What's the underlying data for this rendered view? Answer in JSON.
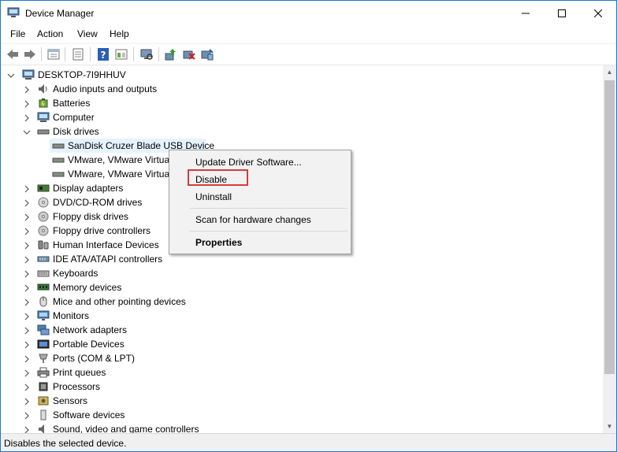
{
  "window": {
    "title": "Device Manager",
    "controls": {
      "minimize": "–",
      "maximize": "☐",
      "close": "✕"
    }
  },
  "menu": [
    "File",
    "Action",
    "View",
    "Help"
  ],
  "toolbar": [
    "back-icon",
    "forward-icon",
    "properties-view-icon",
    "show-hidden-icon",
    "help-icon",
    "view-icon",
    "scan-icon",
    "update-driver-icon",
    "disable-device-icon",
    "uninstall-device-icon"
  ],
  "tree": {
    "root": "DESKTOP-7I9HHUV",
    "items": [
      {
        "label": "Audio inputs and outputs",
        "icon": "speaker-icon"
      },
      {
        "label": "Batteries",
        "icon": "battery-icon"
      },
      {
        "label": "Computer",
        "icon": "computer-icon"
      },
      {
        "label": "Disk drives",
        "icon": "disk-drive-icon",
        "expanded": true,
        "children": [
          {
            "label": "SanDisk Cruzer Blade USB Device",
            "selected": true
          },
          {
            "label": "VMware, VMware Virtua"
          },
          {
            "label": "VMware, VMware Virtua"
          }
        ]
      },
      {
        "label": "Display adapters",
        "icon": "display-adapter-icon"
      },
      {
        "label": "DVD/CD-ROM drives",
        "icon": "dvd-icon"
      },
      {
        "label": "Floppy disk drives",
        "icon": "floppy-icon"
      },
      {
        "label": "Floppy drive controllers",
        "icon": "floppy-controller-icon"
      },
      {
        "label": "Human Interface Devices",
        "icon": "hid-icon"
      },
      {
        "label": "IDE ATA/ATAPI controllers",
        "icon": "ide-icon"
      },
      {
        "label": "Keyboards",
        "icon": "keyboard-icon"
      },
      {
        "label": "Memory devices",
        "icon": "memory-icon"
      },
      {
        "label": "Mice and other pointing devices",
        "icon": "mouse-icon"
      },
      {
        "label": "Monitors",
        "icon": "monitor-icon"
      },
      {
        "label": "Network adapters",
        "icon": "network-icon"
      },
      {
        "label": "Portable Devices",
        "icon": "portable-device-icon"
      },
      {
        "label": "Ports (COM & LPT)",
        "icon": "port-icon"
      },
      {
        "label": "Print queues",
        "icon": "printer-icon"
      },
      {
        "label": "Processors",
        "icon": "processor-icon"
      },
      {
        "label": "Sensors",
        "icon": "sensor-icon"
      },
      {
        "label": "Software devices",
        "icon": "software-device-icon"
      },
      {
        "label": "Sound, video and game controllers",
        "icon": "sound-icon"
      }
    ]
  },
  "context_menu": {
    "update": "Update Driver Software...",
    "disable": "Disable",
    "uninstall": "Uninstall",
    "scan": "Scan for hardware changes",
    "properties": "Properties"
  },
  "status": "Disables the selected device."
}
